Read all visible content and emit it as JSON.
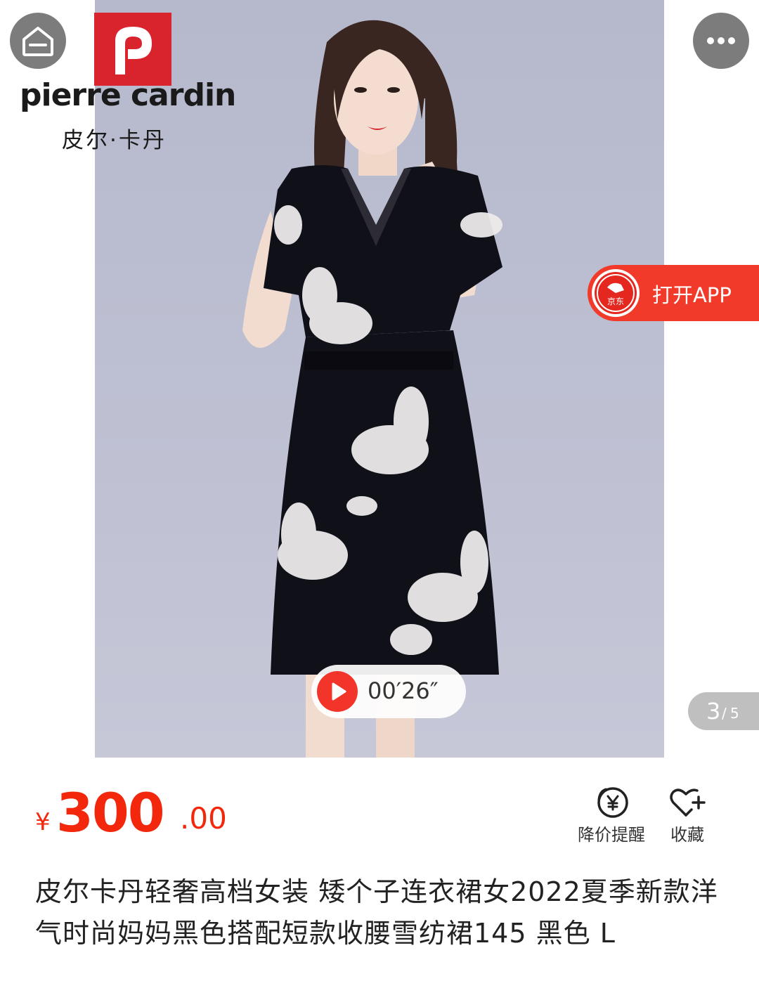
{
  "brand": {
    "name_en": "pierre cardin",
    "name_cn": "皮尔·卡丹"
  },
  "gallery": {
    "video_time": "00′26″",
    "page_current": "3",
    "page_separator": "/",
    "page_total": "5"
  },
  "open_app": {
    "label": "打开APP",
    "logo_text": "京东"
  },
  "icons": {
    "home": "home-icon",
    "more": "more-dots-icon",
    "play": "play-icon",
    "price_alert": "yen-bell-icon",
    "favorite": "heart-plus-icon"
  },
  "price": {
    "symbol": "¥",
    "integer": "300",
    "decimal": ".00",
    "color": "#f2270c"
  },
  "actions": {
    "price_alert_label": "降价提醒",
    "favorite_label": "收藏"
  },
  "product": {
    "title": "皮尔卡丹轻奢高档女装 矮个子连衣裙女2022夏季新款洋气时尚妈妈黑色搭配短款收腰雪纺裙145 黑色 L"
  },
  "colors": {
    "accent_red": "#f23a2b",
    "photo_bg": "#bcbed1"
  }
}
